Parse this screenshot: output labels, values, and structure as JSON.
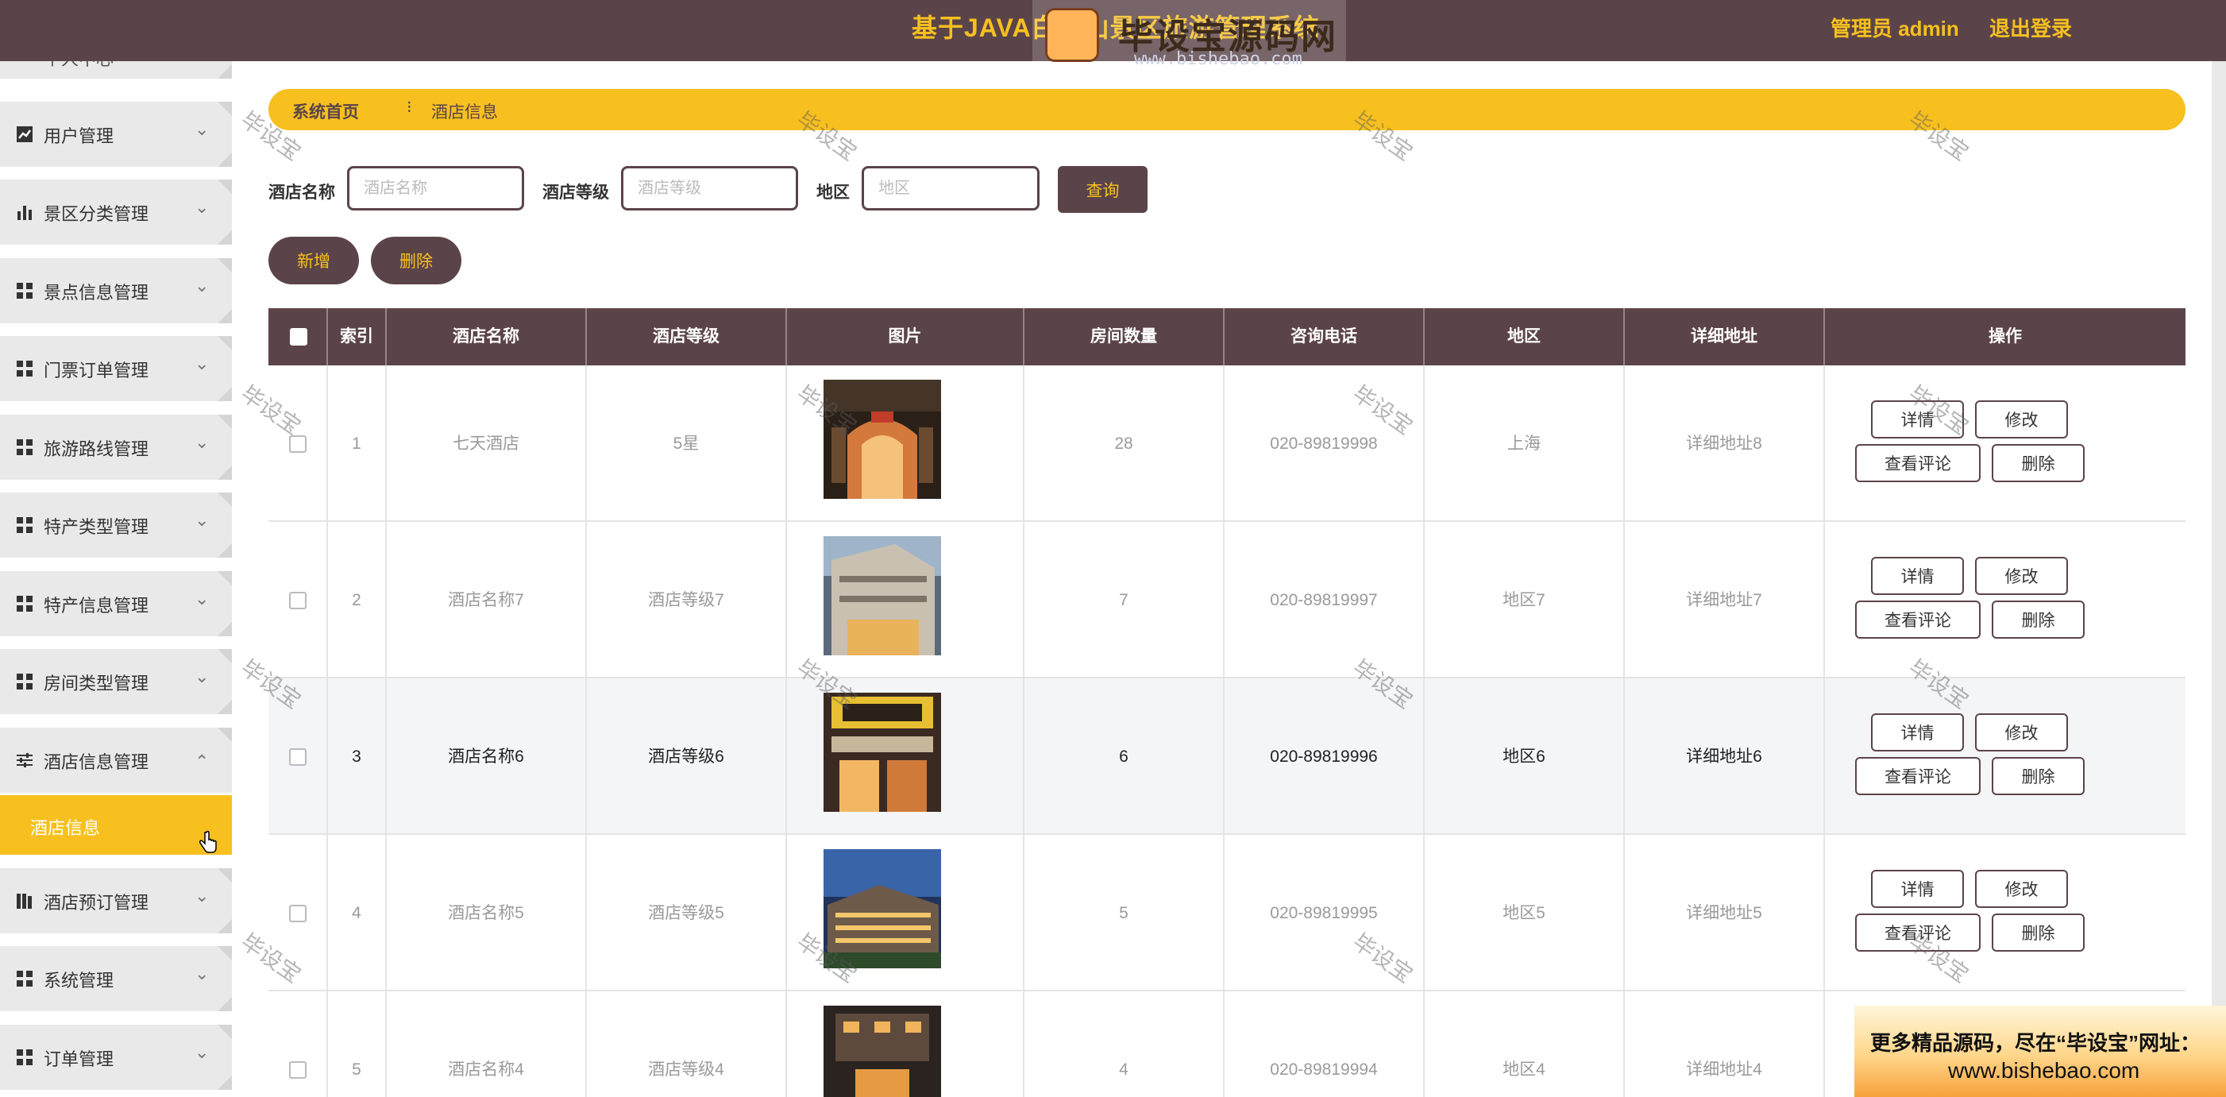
{
  "header": {
    "title": "基于JAVA白云山景区旅游管理系统",
    "admin": "管理员 admin",
    "logout": "退出登录"
  },
  "watermark": {
    "brand": "毕设宝源码网",
    "url": "www.bishebao.com",
    "stamp": "毕设宝",
    "corner_line1": "更多精品源码，尽在“毕设宝”网址：",
    "corner_line2": "www.bishebao.com"
  },
  "sidebar": {
    "items": [
      {
        "label": "用户管理",
        "icon": "chart-line-icon"
      },
      {
        "label": "景区分类管理",
        "icon": "bar-chart-icon"
      },
      {
        "label": "景点信息管理",
        "icon": "grid-icon"
      },
      {
        "label": "门票订单管理",
        "icon": "grid-icon"
      },
      {
        "label": "旅游路线管理",
        "icon": "grid-icon"
      },
      {
        "label": "特产类型管理",
        "icon": "grid-icon"
      },
      {
        "label": "特产信息管理",
        "icon": "grid-icon"
      },
      {
        "label": "房间类型管理",
        "icon": "grid-icon"
      },
      {
        "label": "酒店信息管理",
        "icon": "sliders-icon",
        "expanded": true
      },
      {
        "label": "酒店预订管理",
        "icon": "book-icon"
      },
      {
        "label": "系统管理",
        "icon": "grid-icon"
      },
      {
        "label": "订单管理",
        "icon": "grid-icon"
      }
    ],
    "active_sub": "酒店信息",
    "top_partial": "个人中心"
  },
  "breadcrumb": {
    "home": "系统首页",
    "sep": "⁝",
    "current": "酒店信息"
  },
  "search": {
    "name_label": "酒店名称",
    "name_placeholder": "酒店名称",
    "level_label": "酒店等级",
    "level_placeholder": "酒店等级",
    "area_label": "地区",
    "area_placeholder": "地区",
    "query": "查询"
  },
  "actions": {
    "add": "新增",
    "delete": "删除"
  },
  "table": {
    "headers": [
      "",
      "索引",
      "酒店名称",
      "酒店等级",
      "图片",
      "房间数量",
      "咨询电话",
      "地区",
      "详细地址",
      "操作"
    ],
    "rows": [
      {
        "index": "1",
        "name": "七天酒店",
        "level": "5星",
        "rooms": "28",
        "phone": "020-89819998",
        "area": "上海",
        "addr": "详细地址8"
      },
      {
        "index": "2",
        "name": "酒店名称7",
        "level": "酒店等级7",
        "rooms": "7",
        "phone": "020-89819997",
        "area": "地区7",
        "addr": "详细地址7"
      },
      {
        "index": "3",
        "name": "酒店名称6",
        "level": "酒店等级6",
        "rooms": "6",
        "phone": "020-89819996",
        "area": "地区6",
        "addr": "详细地址6"
      },
      {
        "index": "4",
        "name": "酒店名称5",
        "level": "酒店等级5",
        "rooms": "5",
        "phone": "020-89819995",
        "area": "地区5",
        "addr": "详细地址5"
      },
      {
        "index": "5",
        "name": "酒店名称4",
        "level": "酒店等级4",
        "rooms": "4",
        "phone": "020-89819994",
        "area": "地区4",
        "addr": "详细地址4"
      }
    ],
    "row_actions": {
      "detail": "详情",
      "edit": "修改",
      "reviews": "查看评论",
      "delete": "删除"
    }
  },
  "colors": {
    "brand": "#5b4449",
    "accent": "#f7c01f"
  }
}
